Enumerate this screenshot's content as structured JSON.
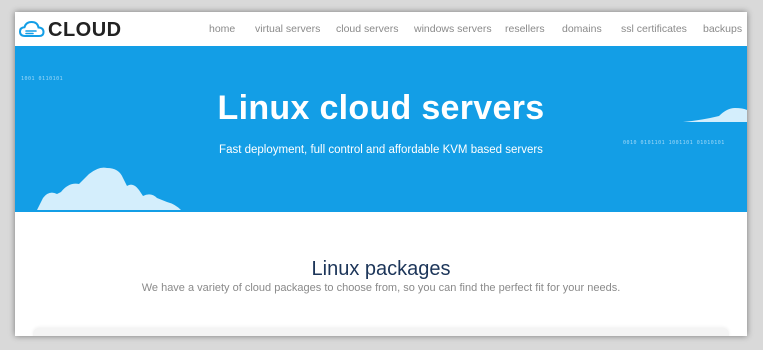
{
  "header": {
    "logo_text": "CLOUD",
    "logo_icon": "cloud-icon",
    "nav": [
      "home",
      "virtual servers",
      "cloud servers",
      "windows servers",
      "resellers",
      "domains",
      "ssl certificates",
      "backups"
    ]
  },
  "hero": {
    "title": "Linux cloud servers",
    "subtitle": "Fast deployment, full control and affordable KVM based servers",
    "bits_left": "1001 0110101",
    "bits_right": "0010 0101101 1001101 01010101"
  },
  "section": {
    "title": "Linux packages",
    "description": "We have a variety of cloud packages to choose from, so you can find the perfect fit for your needs."
  },
  "colors": {
    "hero_bg": "#139ee6",
    "title_dark": "#1c3559",
    "nav_gray": "#8a8a8a"
  }
}
